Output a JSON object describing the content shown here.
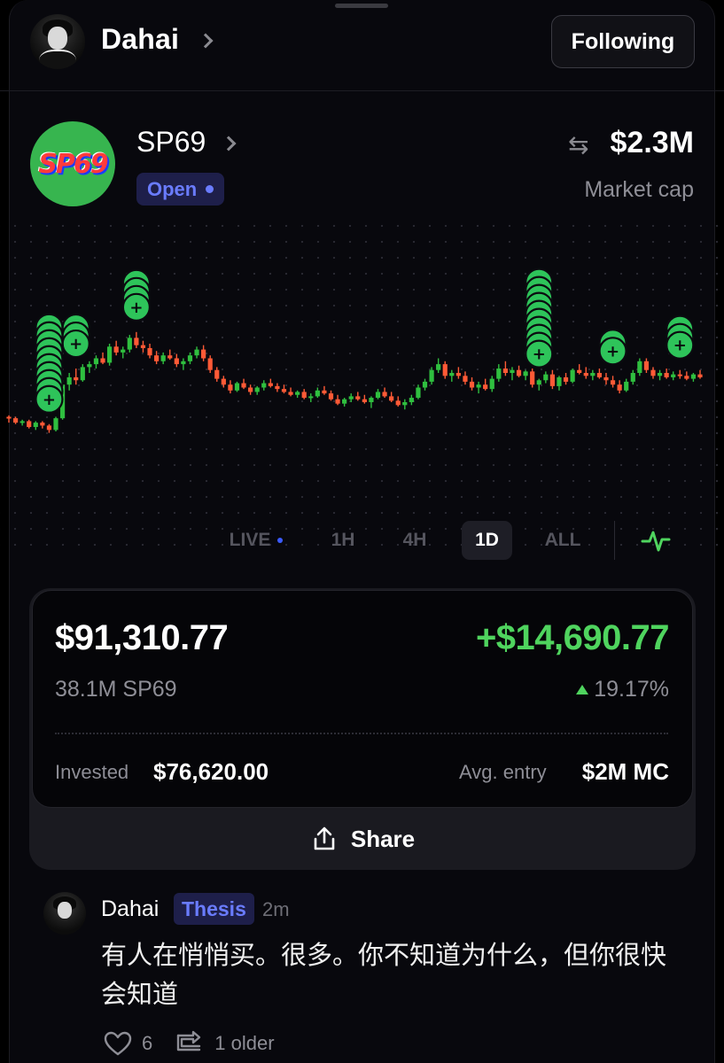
{
  "header": {
    "username": "Dahai",
    "follow_label": "Following"
  },
  "token": {
    "logo_text": "SP69",
    "name": "SP69",
    "status": "Open",
    "market_cap": "$2.3M",
    "market_cap_label": "Market cap",
    "colors": {
      "up": "#2fbf3f",
      "down": "#ff5a36",
      "brand_badge": "#6a7cff"
    }
  },
  "timeframes": {
    "items": [
      "LIVE",
      "1H",
      "4H",
      "1D",
      "ALL"
    ],
    "active": "1D"
  },
  "position": {
    "value": "$91,310.77",
    "pnl": "+$14,690.77",
    "quantity": "38.1M SP69",
    "pnl_pct": "19.17%",
    "invested_label": "Invested",
    "invested_value": "$76,620.00",
    "avg_entry_label": "Avg. entry",
    "avg_entry_value": "$2M MC",
    "share_label": "Share"
  },
  "comment": {
    "author": "Dahai",
    "tag": "Thesis",
    "time": "2m",
    "text": "有人在悄悄买。很多。你不知道为什么，但你很快会知道",
    "likes": "6",
    "older_label": "1 older"
  },
  "chart_data": {
    "type": "candlestick",
    "title": "",
    "note": "unlabeled price chart; values are relative price levels (0 = lowest visible, 100 = highest visible)",
    "ohlc": [
      [
        30,
        31,
        26,
        29
      ],
      [
        29,
        30,
        25,
        26
      ],
      [
        26,
        28,
        24,
        27
      ],
      [
        27,
        28,
        22,
        23
      ],
      [
        23,
        27,
        21,
        26
      ],
      [
        26,
        27,
        22,
        24
      ],
      [
        24,
        25,
        19,
        21
      ],
      [
        21,
        30,
        20,
        29
      ],
      [
        29,
        55,
        28,
        52
      ],
      [
        52,
        60,
        48,
        57
      ],
      [
        57,
        63,
        52,
        55
      ],
      [
        55,
        66,
        54,
        64
      ],
      [
        64,
        68,
        60,
        66
      ],
      [
        66,
        72,
        63,
        70
      ],
      [
        70,
        74,
        66,
        67
      ],
      [
        67,
        80,
        65,
        78
      ],
      [
        78,
        82,
        72,
        74
      ],
      [
        74,
        78,
        70,
        76
      ],
      [
        76,
        86,
        74,
        84
      ],
      [
        84,
        88,
        77,
        79
      ],
      [
        79,
        82,
        74,
        77
      ],
      [
        77,
        80,
        70,
        72
      ],
      [
        72,
        75,
        66,
        68
      ],
      [
        68,
        74,
        66,
        72
      ],
      [
        72,
        76,
        69,
        70
      ],
      [
        70,
        73,
        64,
        66
      ],
      [
        66,
        70,
        62,
        68
      ],
      [
        68,
        74,
        66,
        72
      ],
      [
        72,
        78,
        70,
        76
      ],
      [
        76,
        79,
        68,
        70
      ],
      [
        70,
        72,
        60,
        62
      ],
      [
        62,
        64,
        54,
        56
      ],
      [
        56,
        58,
        50,
        52
      ],
      [
        52,
        55,
        46,
        48
      ],
      [
        48,
        54,
        47,
        53
      ],
      [
        53,
        56,
        49,
        50
      ],
      [
        50,
        52,
        45,
        47
      ],
      [
        47,
        51,
        45,
        50
      ],
      [
        50,
        55,
        48,
        53
      ],
      [
        53,
        56,
        50,
        51
      ],
      [
        51,
        53,
        47,
        49
      ],
      [
        49,
        52,
        46,
        47
      ],
      [
        47,
        50,
        44,
        45
      ],
      [
        45,
        48,
        43,
        47
      ],
      [
        47,
        49,
        42,
        43
      ],
      [
        43,
        46,
        40,
        44
      ],
      [
        44,
        50,
        43,
        48
      ],
      [
        48,
        51,
        45,
        46
      ],
      [
        46,
        48,
        41,
        42
      ],
      [
        42,
        45,
        38,
        39
      ],
      [
        39,
        43,
        37,
        42
      ],
      [
        42,
        46,
        40,
        44
      ],
      [
        44,
        47,
        41,
        42
      ],
      [
        42,
        45,
        39,
        40
      ],
      [
        40,
        44,
        36,
        43
      ],
      [
        43,
        49,
        42,
        47
      ],
      [
        47,
        50,
        43,
        44
      ],
      [
        44,
        47,
        40,
        41
      ],
      [
        41,
        44,
        37,
        38
      ],
      [
        38,
        42,
        35,
        40
      ],
      [
        40,
        45,
        38,
        43
      ],
      [
        43,
        52,
        42,
        50
      ],
      [
        50,
        56,
        48,
        54
      ],
      [
        54,
        64,
        52,
        62
      ],
      [
        62,
        70,
        60,
        66
      ],
      [
        66,
        68,
        56,
        58
      ],
      [
        58,
        62,
        54,
        60
      ],
      [
        60,
        64,
        56,
        58
      ],
      [
        58,
        61,
        52,
        54
      ],
      [
        54,
        57,
        48,
        50
      ],
      [
        50,
        54,
        46,
        52
      ],
      [
        52,
        56,
        48,
        49
      ],
      [
        49,
        58,
        47,
        56
      ],
      [
        56,
        66,
        54,
        63
      ],
      [
        63,
        68,
        58,
        60
      ],
      [
        60,
        64,
        55,
        62
      ],
      [
        62,
        65,
        57,
        58
      ],
      [
        58,
        62,
        55,
        61
      ],
      [
        61,
        63,
        50,
        52
      ],
      [
        52,
        56,
        48,
        55
      ],
      [
        55,
        61,
        53,
        59
      ],
      [
        59,
        62,
        49,
        51
      ],
      [
        51,
        58,
        48,
        57
      ],
      [
        57,
        60,
        52,
        54
      ],
      [
        54,
        63,
        53,
        62
      ],
      [
        62,
        66,
        59,
        60
      ],
      [
        60,
        64,
        56,
        58
      ],
      [
        58,
        62,
        55,
        60
      ],
      [
        60,
        63,
        56,
        57
      ],
      [
        57,
        60,
        52,
        55
      ],
      [
        55,
        58,
        50,
        52
      ],
      [
        52,
        55,
        46,
        48
      ],
      [
        48,
        56,
        47,
        54
      ],
      [
        54,
        62,
        52,
        60
      ],
      [
        60,
        70,
        58,
        68
      ],
      [
        68,
        70,
        60,
        62
      ],
      [
        62,
        64,
        56,
        58
      ],
      [
        58,
        62,
        55,
        60
      ],
      [
        60,
        63,
        56,
        57
      ],
      [
        57,
        61,
        55,
        59
      ],
      [
        59,
        62,
        56,
        58
      ],
      [
        58,
        61,
        55,
        56
      ],
      [
        56,
        60,
        54,
        59
      ],
      [
        59,
        62,
        56,
        57
      ]
    ],
    "markers": [
      {
        "candle": 6,
        "count": 10
      },
      {
        "candle": 10,
        "count": 3
      },
      {
        "candle": 19,
        "count": 4
      },
      {
        "candle": 79,
        "count": 10
      },
      {
        "candle": 90,
        "count": 2
      },
      {
        "candle": 100,
        "count": 3
      }
    ]
  }
}
